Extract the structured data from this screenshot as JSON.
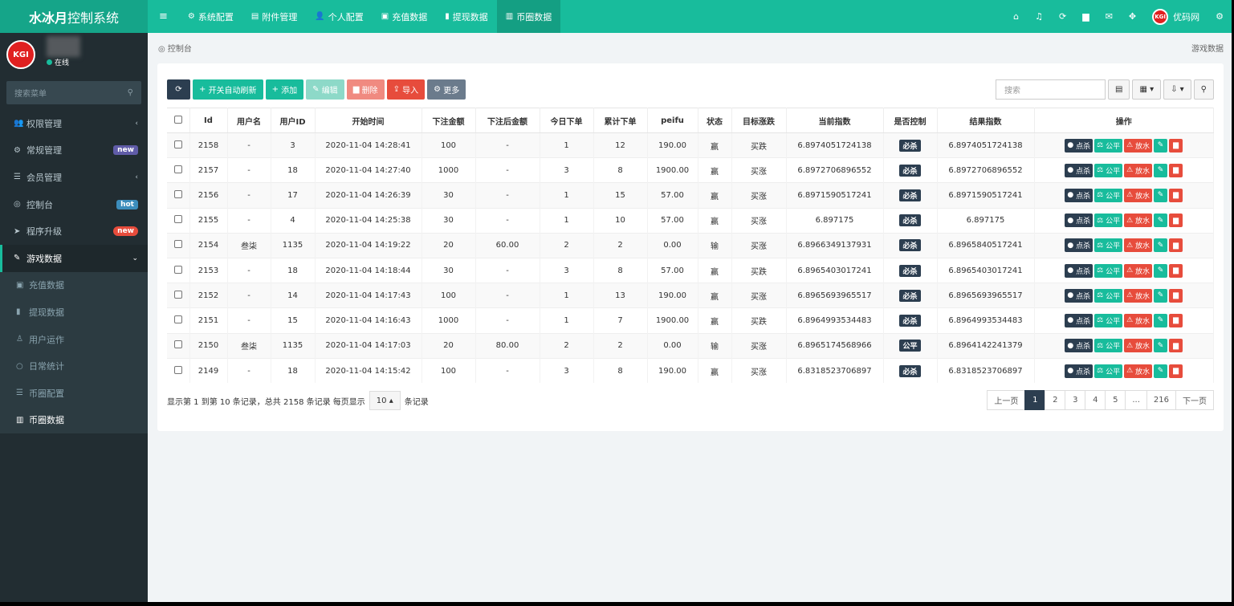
{
  "brand": {
    "bold": "水冰月",
    "rest": "控制系统"
  },
  "nav": [
    {
      "label": "系统配置",
      "icon": "⚙"
    },
    {
      "label": "附件管理",
      "icon": "▤"
    },
    {
      "label": "个人配置",
      "icon": "👤"
    },
    {
      "label": "充值数据",
      "icon": "▣"
    },
    {
      "label": "提现数据",
      "icon": "▮"
    },
    {
      "label": "币圈数据",
      "icon": "▥"
    }
  ],
  "header_right": {
    "user": "优码网",
    "avatar": "KGI"
  },
  "sidebar": {
    "avatar": "KGI",
    "status": "在线",
    "search_placeholder": "搜索菜单",
    "items": [
      {
        "label": "权限管理",
        "icon": "👥"
      },
      {
        "label": "常规管理",
        "icon": "⚙",
        "badge": "new"
      },
      {
        "label": "会员管理",
        "icon": "☰"
      },
      {
        "label": "控制台",
        "icon": "◎",
        "badge": "hot"
      },
      {
        "label": "程序升级",
        "icon": "➤",
        "badge": "new"
      },
      {
        "label": "游戏数据",
        "icon": "✎"
      }
    ],
    "sub_items": [
      {
        "label": "充值数据",
        "icon": "▣"
      },
      {
        "label": "提现数据",
        "icon": "▮"
      },
      {
        "label": "用户运作",
        "icon": "♙"
      },
      {
        "label": "日常统计",
        "icon": "○"
      },
      {
        "label": "币圈配置",
        "icon": "☰"
      },
      {
        "label": "币圈数据",
        "icon": "▥"
      }
    ]
  },
  "breadcrumb": {
    "left": "控制台",
    "right": "游戏数据"
  },
  "toolbar": {
    "refresh": "⟳",
    "auto_refresh": "开关自动刷新",
    "add": "添加",
    "edit": "编辑",
    "delete": "删除",
    "import": "导入",
    "more": "更多",
    "search_placeholder": "搜索"
  },
  "table": {
    "headers": [
      "Id",
      "用户名",
      "用户ID",
      "开始时间",
      "下注金额",
      "下注后金额",
      "今日下单",
      "累计下单",
      "peifu",
      "状态",
      "目标涨跌",
      "当前指数",
      "是否控制",
      "结果指数",
      "操作"
    ],
    "rows": [
      [
        "2158",
        "-",
        "3",
        "2020-11-04 14:28:41",
        "100",
        "-",
        "1",
        "12",
        "190.00",
        "赢",
        "买跌",
        "6.8974051724138",
        "必杀",
        "6.8974051724138"
      ],
      [
        "2157",
        "-",
        "18",
        "2020-11-04 14:27:40",
        "1000",
        "-",
        "3",
        "8",
        "1900.00",
        "赢",
        "买涨",
        "6.8972706896552",
        "必杀",
        "6.8972706896552"
      ],
      [
        "2156",
        "-",
        "17",
        "2020-11-04 14:26:39",
        "30",
        "-",
        "1",
        "15",
        "57.00",
        "赢",
        "买涨",
        "6.8971590517241",
        "必杀",
        "6.8971590517241"
      ],
      [
        "2155",
        "-",
        "4",
        "2020-11-04 14:25:38",
        "30",
        "-",
        "1",
        "10",
        "57.00",
        "赢",
        "买涨",
        "6.897175",
        "必杀",
        "6.897175"
      ],
      [
        "2154",
        "叁柒",
        "1135",
        "2020-11-04 14:19:22",
        "20",
        "60.00",
        "2",
        "2",
        "0.00",
        "输",
        "买涨",
        "6.8966349137931",
        "必杀",
        "6.8965840517241"
      ],
      [
        "2153",
        "-",
        "18",
        "2020-11-04 14:18:44",
        "30",
        "-",
        "3",
        "8",
        "57.00",
        "赢",
        "买跌",
        "6.8965403017241",
        "必杀",
        "6.8965403017241"
      ],
      [
        "2152",
        "-",
        "14",
        "2020-11-04 14:17:43",
        "100",
        "-",
        "1",
        "13",
        "190.00",
        "赢",
        "买涨",
        "6.8965693965517",
        "必杀",
        "6.8965693965517"
      ],
      [
        "2151",
        "-",
        "15",
        "2020-11-04 14:16:43",
        "1000",
        "-",
        "1",
        "7",
        "1900.00",
        "赢",
        "买跌",
        "6.8964993534483",
        "必杀",
        "6.8964993534483"
      ],
      [
        "2150",
        "叁柒",
        "1135",
        "2020-11-04 14:17:03",
        "20",
        "80.00",
        "2",
        "2",
        "0.00",
        "输",
        "买涨",
        "6.8965174568966",
        "公平",
        "6.8964142241379"
      ],
      [
        "2149",
        "-",
        "18",
        "2020-11-04 14:15:42",
        "100",
        "-",
        "3",
        "8",
        "190.00",
        "赢",
        "买涨",
        "6.8318523706897",
        "必杀",
        "6.8318523706897"
      ]
    ],
    "ops": {
      "kill": "点杀",
      "fair": "公平",
      "release": "放水"
    }
  },
  "footer": {
    "summary": "显示第 1 到第 10 条记录，总共 2158 条记录 每页显示",
    "page_size": "10",
    "suffix": "条记录"
  },
  "pager": [
    "上一页",
    "1",
    "2",
    "3",
    "4",
    "5",
    "...",
    "216",
    "下一页"
  ]
}
